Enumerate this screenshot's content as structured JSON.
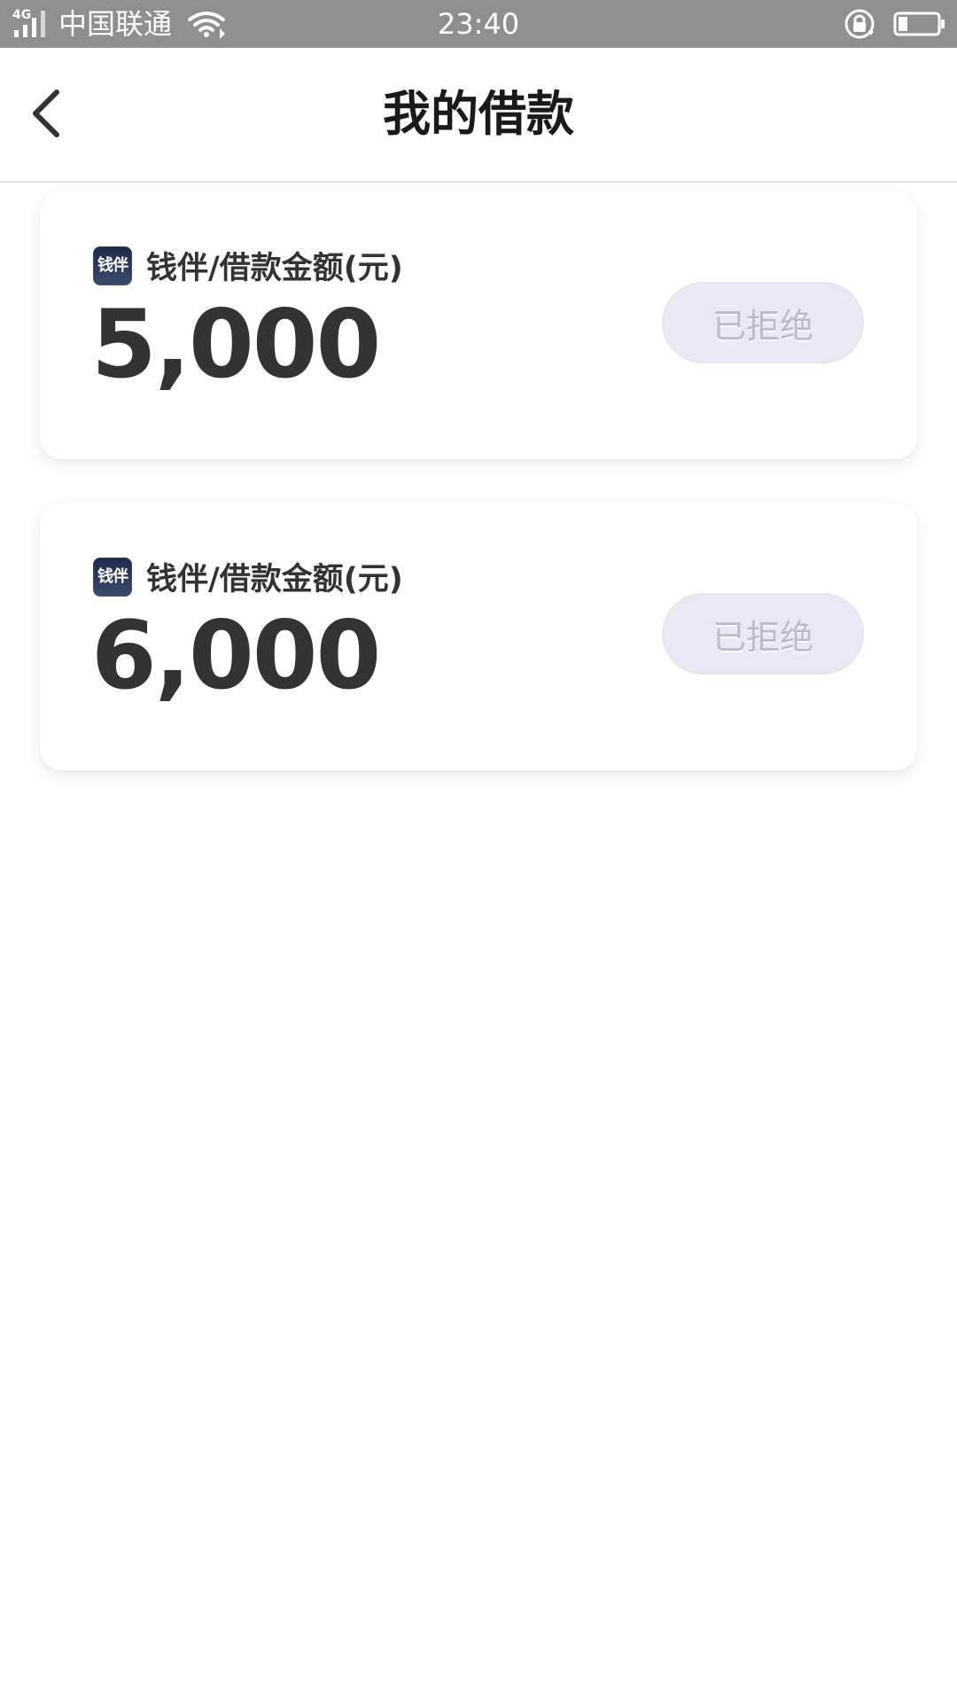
{
  "status_bar": {
    "network_type": "4G",
    "carrier": "中国联通",
    "time": "23:40",
    "icons": [
      "signal-icon",
      "wifi-icon",
      "rotation-lock-icon",
      "battery-icon"
    ]
  },
  "header": {
    "title": "我的借款",
    "back_icon": "chevron-left-icon"
  },
  "loans": [
    {
      "logo_text": "钱伴",
      "label": "钱伴/借款金额(元)",
      "amount": "5,000",
      "status": "已拒绝"
    },
    {
      "logo_text": "钱伴",
      "label": "钱伴/借款金额(元)",
      "amount": "6,000",
      "status": "已拒绝"
    }
  ],
  "colors": {
    "status_bar_bg": "#8f8f8f",
    "text_primary": "#333333",
    "pill_bg": "#e7eaf2",
    "pill_text": "#b8bccb"
  }
}
